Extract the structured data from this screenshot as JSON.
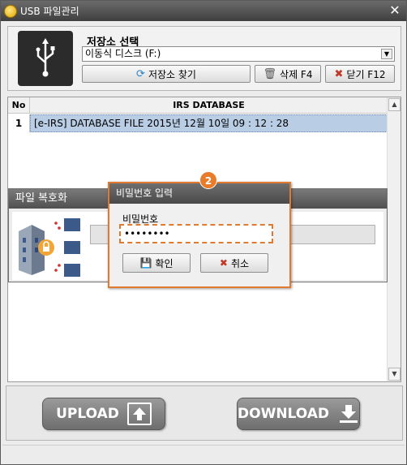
{
  "window": {
    "title": "USB 파일관리",
    "close_glyph": "✕"
  },
  "storage": {
    "label": "저장소 선택",
    "selected": "이동식 디스크 (F:)",
    "find_button": "저장소 찾기",
    "delete_button": "삭제 F4",
    "close_button": "닫기 F12"
  },
  "table": {
    "headers": {
      "no": "No",
      "name": "IRS DATABASE"
    },
    "rows": [
      {
        "no": "1",
        "name": "[e-IRS] DATABASE FILE  2015년 12월 10일 09 : 12 : 28"
      }
    ]
  },
  "decrypt_panel": {
    "title": "파일 복호화"
  },
  "password_dialog": {
    "title": "비밀번호 입력",
    "label": "비밀번호",
    "value": "••••••••",
    "ok_button": "확인",
    "cancel_button": "취소",
    "step_badge": "2"
  },
  "actions": {
    "upload": "UPLOAD",
    "download": "DOWNLOAD"
  },
  "colors": {
    "accent": "#e87c2b",
    "selection": "#b9cde5",
    "header_dark": "#4a4a4a"
  }
}
